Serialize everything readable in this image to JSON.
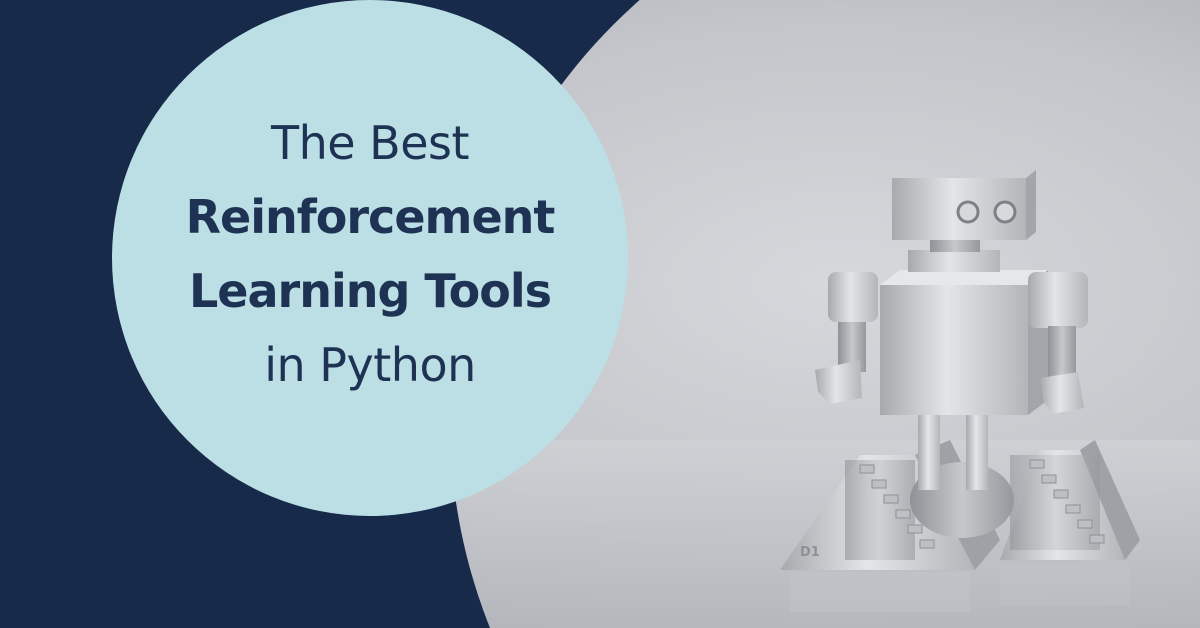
{
  "colors": {
    "navy_background": "#172a4a",
    "circle_fill": "#bcdfe6",
    "title_text": "#1e3253",
    "photo_gray": "#c9cbd0"
  },
  "title": {
    "line1": "The Best",
    "line2": "Reinforcement",
    "line3": "Learning Tools",
    "line4": "in Python"
  },
  "image": {
    "subject": "robot-figure",
    "base_marking": "D1"
  }
}
